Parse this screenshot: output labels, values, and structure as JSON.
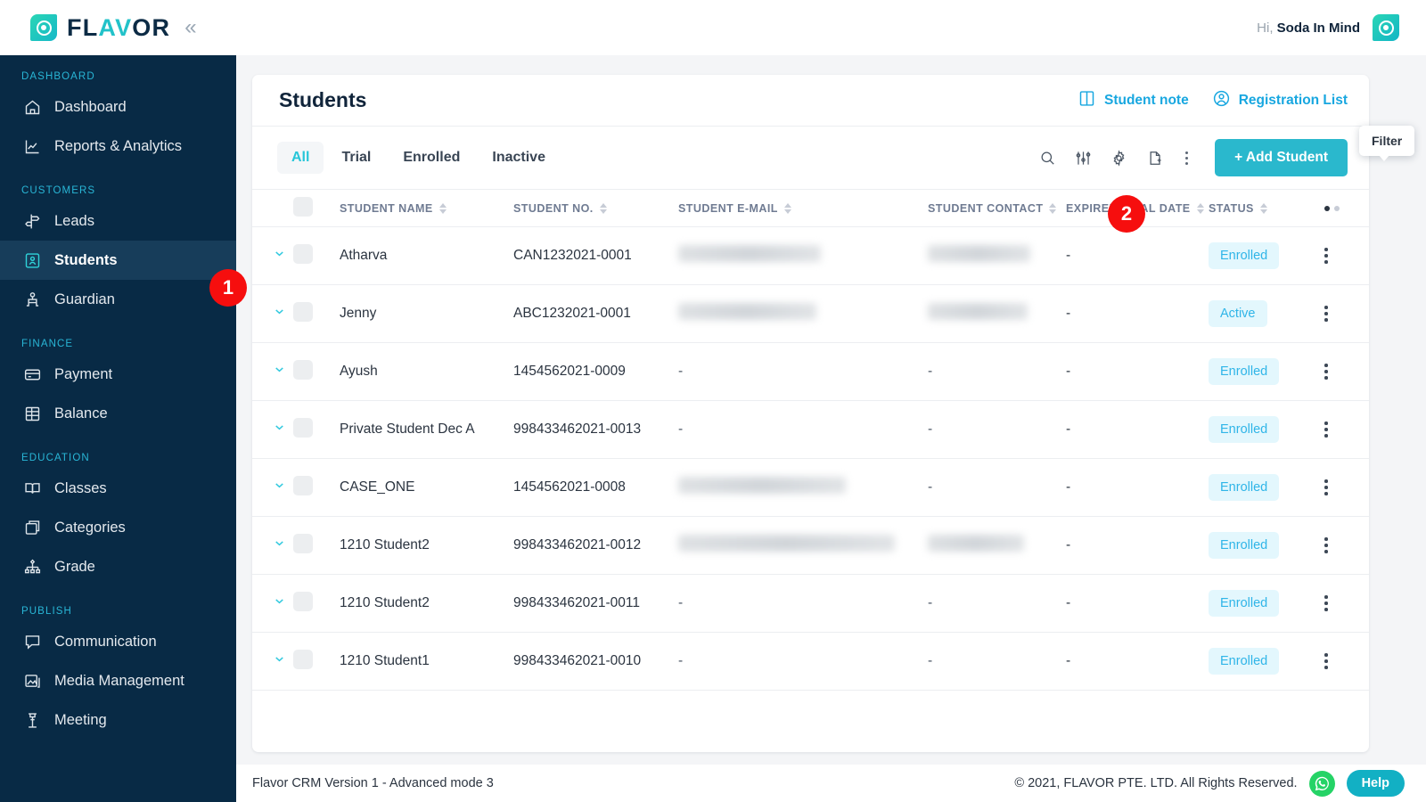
{
  "brand": {
    "name_dark_1": "FL",
    "name_accent": "AV",
    "name_dark_2": "OR",
    "collapse_icon": "chevron-double-left-icon"
  },
  "topbar": {
    "greeting_prefix": "Hi,",
    "user_name": "Soda In Mind"
  },
  "sidebar": {
    "groups": [
      {
        "label": "DASHBOARD",
        "items": [
          {
            "label": "Dashboard",
            "icon": "home-icon",
            "active": false
          },
          {
            "label": "Reports & Analytics",
            "icon": "chart-line-icon",
            "active": false
          }
        ]
      },
      {
        "label": "CUSTOMERS",
        "items": [
          {
            "label": "Leads",
            "icon": "signpost-icon",
            "active": false
          },
          {
            "label": "Students",
            "icon": "student-badge-icon",
            "active": true
          },
          {
            "label": "Guardian",
            "icon": "guardian-icon",
            "active": false
          }
        ]
      },
      {
        "label": "FINANCE",
        "items": [
          {
            "label": "Payment",
            "icon": "credit-card-icon",
            "active": false
          },
          {
            "label": "Balance",
            "icon": "ledger-icon",
            "active": false
          }
        ]
      },
      {
        "label": "EDUCATION",
        "items": [
          {
            "label": "Classes",
            "icon": "open-book-icon",
            "active": false
          },
          {
            "label": "Categories",
            "icon": "box-stack-icon",
            "active": false
          },
          {
            "label": "Grade",
            "icon": "grade-node-icon",
            "active": false
          }
        ]
      },
      {
        "label": "PUBLISH",
        "items": [
          {
            "label": "Communication",
            "icon": "chat-bubble-icon",
            "active": false
          },
          {
            "label": "Media Management",
            "icon": "image-stack-icon",
            "active": false
          },
          {
            "label": "Meeting",
            "icon": "podium-icon",
            "active": false
          }
        ]
      }
    ]
  },
  "card": {
    "title": "Students",
    "head_links": [
      {
        "label": "Student note",
        "icon": "book-icon"
      },
      {
        "label": "Registration List",
        "icon": "user-circle-icon"
      }
    ],
    "accent_color": "#18a7e0"
  },
  "toolbar": {
    "tabs": [
      {
        "label": "All",
        "active": true
      },
      {
        "label": "Trial",
        "active": false
      },
      {
        "label": "Enrolled",
        "active": false
      },
      {
        "label": "Inactive",
        "active": false
      }
    ],
    "icons": [
      {
        "name": "search-icon"
      },
      {
        "name": "filter-sliders-icon"
      },
      {
        "name": "gear-icon"
      },
      {
        "name": "document-add-icon"
      },
      {
        "name": "kebab-menu-icon"
      }
    ],
    "add_button_label": "+ Add Student",
    "add_button_color": "#2ab8cd",
    "tooltip": "Filter"
  },
  "table": {
    "columns": [
      {
        "label": "STUDENT NAME",
        "sortable": true
      },
      {
        "label": "STUDENT NO.",
        "sortable": true
      },
      {
        "label": "STUDENT E-MAIL",
        "sortable": true
      },
      {
        "label": "STUDENT CONTACT",
        "sortable": true
      },
      {
        "label": "EXPIRED TRIAL DATE",
        "sortable": true
      },
      {
        "label": "STATUS",
        "sortable": true
      }
    ],
    "rows": [
      {
        "name": "Atharva",
        "no": "CAN1232021-0001",
        "email": "",
        "email_blurred": true,
        "email_w": 160,
        "contact": "",
        "contact_blurred": true,
        "contact_w": 115,
        "expired": "-",
        "status": "Enrolled"
      },
      {
        "name": "Jenny",
        "no": "ABC1232021-0001",
        "email": "",
        "email_blurred": true,
        "email_w": 155,
        "contact": "",
        "contact_blurred": true,
        "contact_w": 112,
        "expired": "-",
        "status": "Active"
      },
      {
        "name": "Ayush",
        "no": "1454562021-0009",
        "email": "-",
        "email_blurred": false,
        "contact": "-",
        "contact_blurred": false,
        "expired": "-",
        "status": "Enrolled"
      },
      {
        "name": "Private Student Dec A",
        "no": "998433462021-0013",
        "email": "-",
        "email_blurred": false,
        "contact": "-",
        "contact_blurred": false,
        "expired": "-",
        "status": "Enrolled"
      },
      {
        "name": "CASE_ONE",
        "no": "1454562021-0008",
        "email": "",
        "email_blurred": true,
        "email_w": 188,
        "contact": "-",
        "contact_blurred": false,
        "expired": "-",
        "status": "Enrolled"
      },
      {
        "name": "1210 Student2",
        "no": "998433462021-0012",
        "email": "",
        "email_blurred": true,
        "email_w": 243,
        "contact": "",
        "contact_blurred": true,
        "contact_w": 108,
        "expired": "-",
        "status": "Enrolled"
      },
      {
        "name": "1210 Student2",
        "no": "998433462021-0011",
        "email": "-",
        "email_blurred": false,
        "contact": "-",
        "contact_blurred": false,
        "expired": "-",
        "status": "Enrolled"
      },
      {
        "name": "1210 Student1",
        "no": "998433462021-0010",
        "email": "-",
        "email_blurred": false,
        "contact": "-",
        "contact_blurred": false,
        "expired": "-",
        "status": "Enrolled"
      }
    ],
    "status_colors": {
      "text": "#2fb5e8",
      "bg": "#e3f7fd"
    }
  },
  "footer": {
    "version": "Flavor CRM Version 1 - Advanced mode 3",
    "copyright": "© 2021, FLAVOR PTE. LTD. All Rights Reserved.",
    "whatsapp_icon": "whatsapp-icon",
    "help_label": "Help"
  },
  "markers": [
    {
      "label": "1"
    },
    {
      "label": "2"
    }
  ]
}
